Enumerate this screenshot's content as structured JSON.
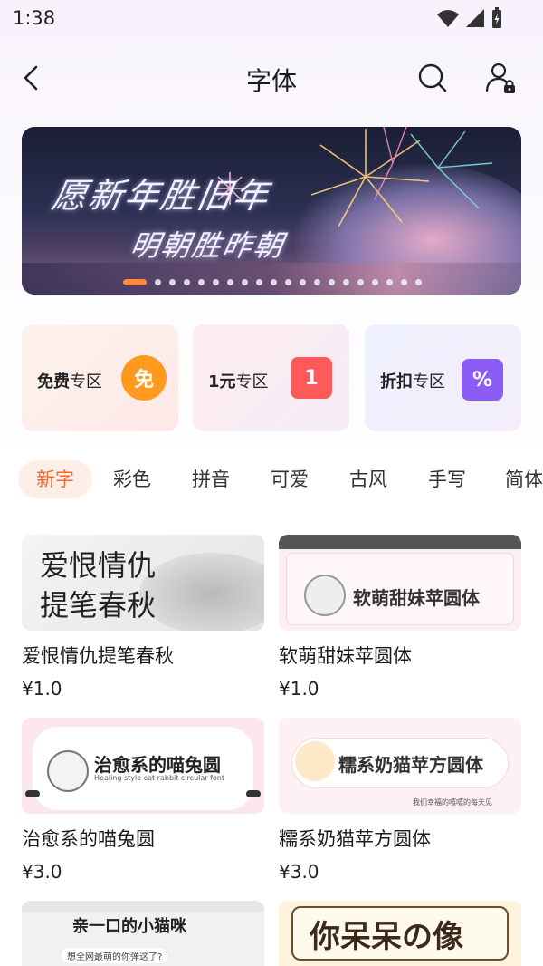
{
  "status": {
    "time": "1:38"
  },
  "header": {
    "title": "字体"
  },
  "banner": {
    "line1": "愿新年胜旧年",
    "line2": "明朝胜昨朝",
    "dot_count": 20,
    "active_dot": 0
  },
  "zones": [
    {
      "label_bold": "免费",
      "label_rest": "专区",
      "badge": "免",
      "badge_color": "#ff9a1f"
    },
    {
      "label_bold": "1元",
      "label_rest": "专区",
      "badge": "1",
      "badge_color": "#ff5a5a"
    },
    {
      "label_bold": "折扣",
      "label_rest": "专区",
      "badge": "%",
      "badge_color": "#8b5cf6"
    }
  ],
  "categories": [
    "新字",
    "彩色",
    "拼音",
    "可爱",
    "古风",
    "手写",
    "简体"
  ],
  "active_category": 0,
  "fonts": [
    {
      "title": "爱恨情仇提笔春秋",
      "price": "¥1.0",
      "preview": "爱恨情仇\n提笔春秋"
    },
    {
      "title": "软萌甜妹苹圆体",
      "price": "¥1.0",
      "preview": "软萌甜妹苹圆体"
    },
    {
      "title": "治愈系的喵兔圆",
      "price": "¥3.0",
      "preview": "治愈系的喵兔圆",
      "preview_sub": "Healing style cat rabbit circular font"
    },
    {
      "title": "糯系奶猫苹方圆体",
      "price": "¥3.0",
      "preview": "糯系奶猫苹方圆体",
      "preview_sub": "我们幸福的嘻嘻的每天见"
    },
    {
      "preview": "亲一口的小猫咪",
      "preview_sub": "想全网最萌的你弹这了?"
    },
    {
      "preview": "你呆呆の像"
    }
  ],
  "colors": {
    "accent": "#f36a2a",
    "accent_bg": "#fdeee7"
  }
}
